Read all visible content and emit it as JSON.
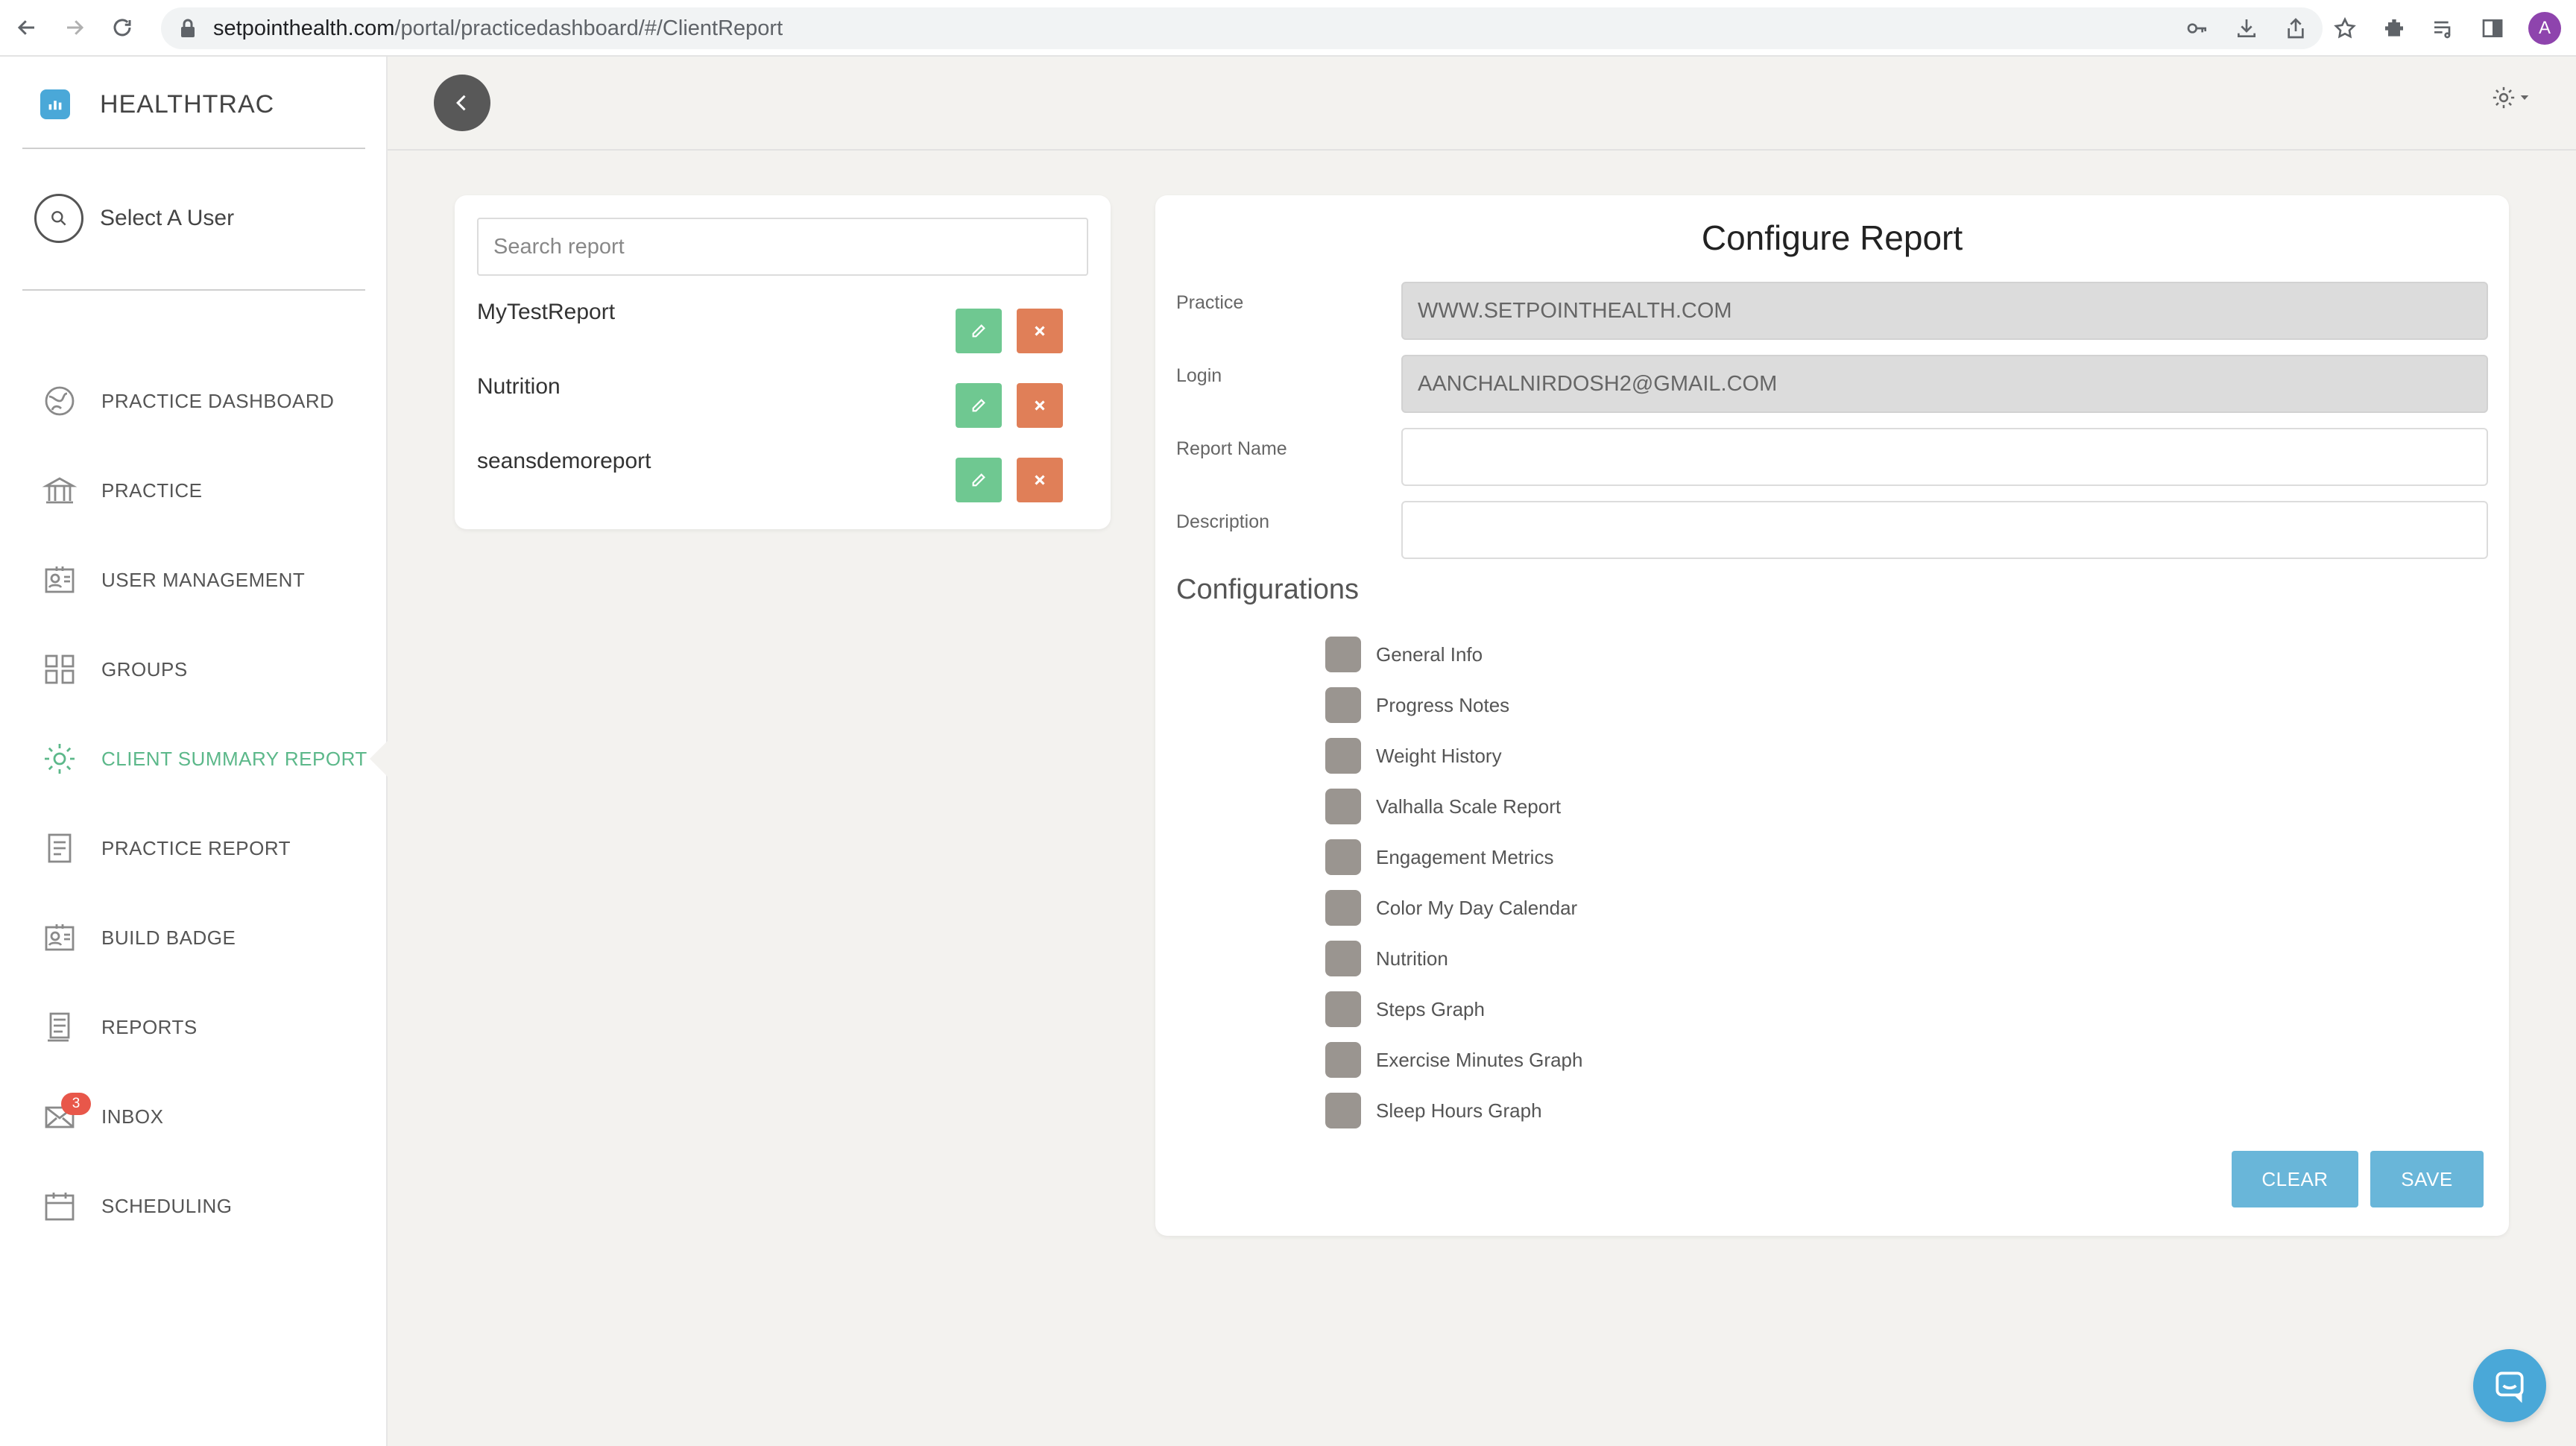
{
  "browser": {
    "url_host": "setpointhealth.com",
    "url_path": "/portal/practicedashboard/#/ClientReport",
    "profile_initial": "A"
  },
  "sidebar": {
    "brand": "HEALTHTRAC",
    "user_select_label": "Select A User",
    "items": [
      {
        "label": "PRACTICE DASHBOARD",
        "icon": "dashboard-icon"
      },
      {
        "label": "PRACTICE",
        "icon": "building-icon"
      },
      {
        "label": "USER MANAGEMENT",
        "icon": "id-card-icon"
      },
      {
        "label": "GROUPS",
        "icon": "grid-icon"
      },
      {
        "label": "CLIENT SUMMARY REPORT",
        "icon": "gear-icon",
        "active": true
      },
      {
        "label": "PRACTICE REPORT",
        "icon": "document-icon"
      },
      {
        "label": "BUILD BADGE",
        "icon": "badge-icon"
      },
      {
        "label": "REPORTS",
        "icon": "report-icon"
      },
      {
        "label": "INBOX",
        "icon": "mail-icon",
        "badge": "3"
      },
      {
        "label": "SCHEDULING",
        "icon": "calendar-icon"
      }
    ],
    "active_color": "#5cb88a"
  },
  "report_list": {
    "search_placeholder": "Search report",
    "reports": [
      "MyTestReport",
      "Nutrition",
      "seansdemoreport"
    ]
  },
  "configure": {
    "title": "Configure Report",
    "practice_label": "Practice",
    "practice_value": "WWW.SETPOINTHEALTH.COM",
    "login_label": "Login",
    "login_value": "AANCHALNIRDOSH2@GMAIL.COM",
    "report_name_label": "Report Name",
    "report_name_value": "",
    "description_label": "Description",
    "description_value": "",
    "configurations_heading": "Configurations",
    "options": [
      "General Info",
      "Progress Notes",
      "Weight History",
      "Valhalla Scale Report",
      "Engagement Metrics",
      "Color My Day Calendar",
      "Nutrition",
      "Steps Graph",
      "Exercise Minutes Graph",
      "Sleep Hours Graph"
    ],
    "clear_label": "CLEAR",
    "save_label": "SAVE"
  },
  "colors": {
    "edit_button": "#6fc891",
    "delete_button": "#e07f58",
    "action_button": "#69b6d9"
  }
}
